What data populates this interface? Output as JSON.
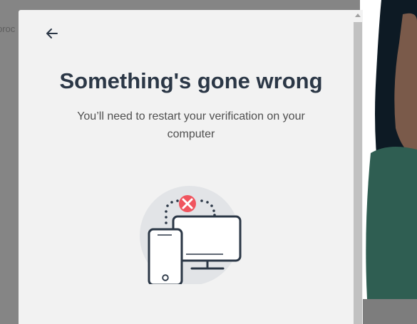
{
  "background": {
    "partial_text": "proc"
  },
  "dialog": {
    "back_icon": "arrow-left-icon",
    "title": "Something's gone wrong",
    "message": "You’ll need to restart your verification on your computer",
    "illustration": {
      "icons": [
        "phone-icon",
        "monitor-icon",
        "error-x-icon"
      ]
    }
  },
  "colors": {
    "title": "#2b3746",
    "error": "#f0555f",
    "device_stroke": "#2b3746",
    "circle_bg": "#e2e4e7"
  }
}
